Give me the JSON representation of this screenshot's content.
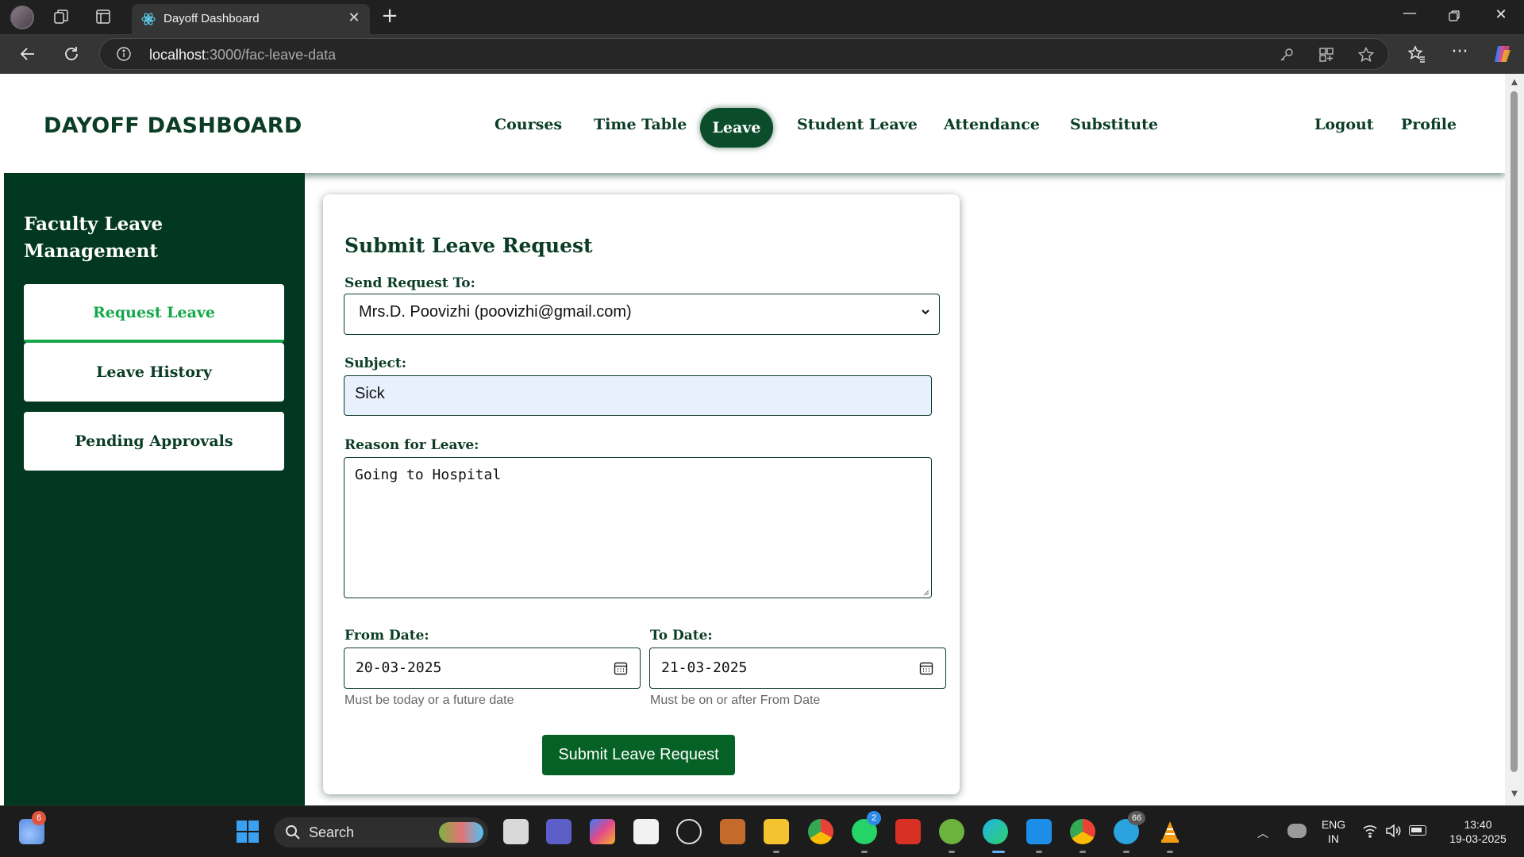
{
  "browser": {
    "tab_title": "Dayoff Dashboard",
    "url_host": "localhost",
    "url_rest": ":3000/fac-leave-data"
  },
  "header": {
    "brand": "DAYOFF DASHBOARD",
    "menu": [
      "Courses",
      "Time Table",
      "Leave",
      "Student Leave",
      "Attendance",
      "Substitute"
    ],
    "active_menu": "Leave",
    "logout": "Logout",
    "profile": "Profile"
  },
  "sidebar": {
    "title": "Faculty Leave Management",
    "items": [
      "Request Leave",
      "Leave History",
      "Pending Approvals"
    ],
    "active": "Request Leave"
  },
  "form": {
    "title": "Submit Leave Request",
    "send_to_label": "Send Request To:",
    "send_to_value": "Mrs.D. Poovizhi (poovizhi@gmail.com)",
    "subject_label": "Subject:",
    "subject_value": "Sick",
    "reason_label": "Reason for Leave:",
    "reason_value": "Going to Hospital",
    "from_label": "From Date:",
    "from_value": "20-03-2025",
    "from_hint": "Must be today or a future date",
    "to_label": "To Date:",
    "to_value": "21-03-2025",
    "to_hint": "Must be on or after From Date",
    "submit": "Submit Leave Request"
  },
  "taskbar": {
    "search": "Search",
    "weather_badge": "6",
    "whatsapp_badge": "2",
    "telegram_badge": "66",
    "lang_line1": "ENG",
    "lang_line2": "IN",
    "time": "13:40",
    "date": "19-03-2025"
  },
  "colors": {
    "brand_green": "#0b3d26",
    "sidebar_bg": "#023821",
    "active_green": "#14a84a",
    "submit_bg": "#056125"
  }
}
